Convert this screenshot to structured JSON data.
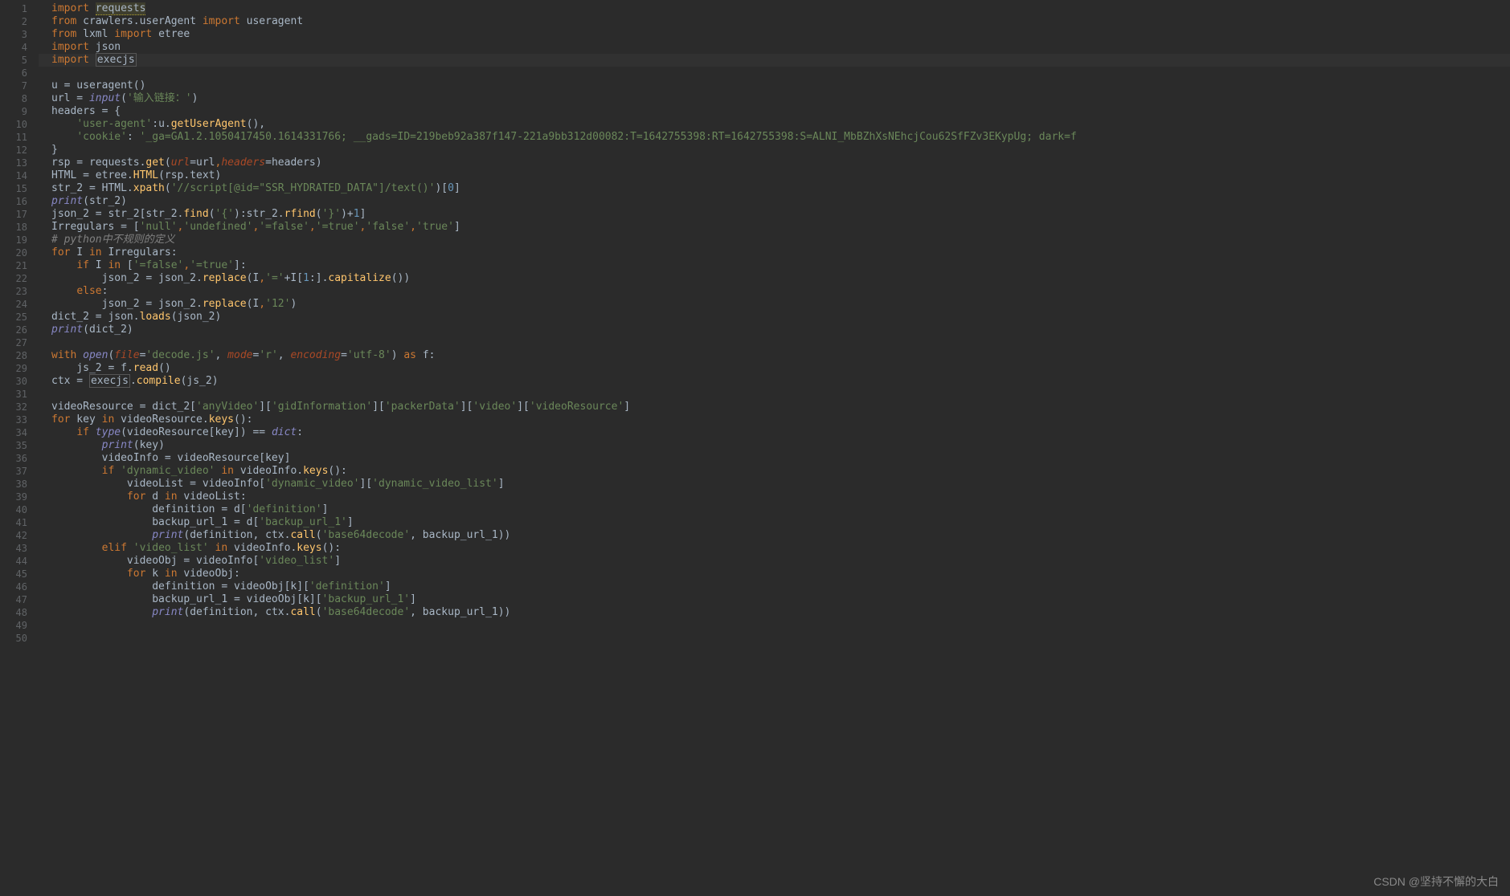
{
  "lineCount": 50,
  "caretLine": 5,
  "watermark": "CSDN @坚持不懈的大白",
  "code": {
    "lines": [
      {
        "n": 1,
        "tokens": [
          [
            "kw",
            "import"
          ],
          [
            "op",
            " "
          ],
          [
            "warn",
            "requests"
          ]
        ]
      },
      {
        "n": 2,
        "tokens": [
          [
            "kw",
            "from"
          ],
          [
            "op",
            " crawlers.userAgent "
          ],
          [
            "kw",
            "import"
          ],
          [
            "op",
            " useragent"
          ]
        ]
      },
      {
        "n": 3,
        "tokens": [
          [
            "kw",
            "from"
          ],
          [
            "op",
            " lxml "
          ],
          [
            "kw",
            "import"
          ],
          [
            "op",
            " etree"
          ]
        ]
      },
      {
        "n": 4,
        "tokens": [
          [
            "kw",
            "import"
          ],
          [
            "op",
            " json"
          ]
        ]
      },
      {
        "n": 5,
        "tokens": [
          [
            "kw",
            "import"
          ],
          [
            "op",
            " "
          ],
          [
            "boxed",
            "execjs"
          ]
        ]
      },
      {
        "n": 6,
        "tokens": []
      },
      {
        "n": 7,
        "tokens": [
          [
            "op",
            "u = useragent()"
          ]
        ]
      },
      {
        "n": 8,
        "tokens": [
          [
            "op",
            "url = "
          ],
          [
            "builtin",
            "input"
          ],
          [
            "op",
            "("
          ],
          [
            "str",
            "'输入链接：'"
          ],
          [
            "op",
            ")"
          ]
        ]
      },
      {
        "n": 9,
        "tokens": [
          [
            "op",
            "headers = {"
          ]
        ]
      },
      {
        "n": 10,
        "tokens": [
          [
            "op",
            "    "
          ],
          [
            "str",
            "'user-agent'"
          ],
          [
            "op",
            ":"
          ],
          [
            "op",
            "u."
          ],
          [
            "fn",
            "getUserAgent"
          ],
          [
            "op",
            "(),"
          ]
        ]
      },
      {
        "n": 11,
        "tokens": [
          [
            "op",
            "    "
          ],
          [
            "str",
            "'cookie'"
          ],
          [
            "op",
            ": "
          ],
          [
            "str",
            "'_ga=GA1.2.1050417450.1614331766; __gads=ID=219beb92a387f147-221a9bb312d00082:T=1642755398:RT=1642755398:S=ALNI_MbBZhXsNEhcjCou62SfFZv3EKypUg; dark=f"
          ]
        ]
      },
      {
        "n": 12,
        "tokens": [
          [
            "op",
            "}"
          ]
        ]
      },
      {
        "n": 13,
        "tokens": [
          [
            "op",
            "rsp = requests."
          ],
          [
            "fn",
            "get"
          ],
          [
            "op",
            "("
          ],
          [
            "param",
            "url"
          ],
          [
            "op",
            "=url"
          ],
          [
            "kw",
            ","
          ],
          [
            "param",
            "headers"
          ],
          [
            "op",
            "=headers)"
          ]
        ]
      },
      {
        "n": 14,
        "tokens": [
          [
            "op",
            "HTML = etree."
          ],
          [
            "fn",
            "HTML"
          ],
          [
            "op",
            "(rsp.text)"
          ]
        ]
      },
      {
        "n": 15,
        "tokens": [
          [
            "op",
            "str_2 = HTML."
          ],
          [
            "fn",
            "xpath"
          ],
          [
            "op",
            "("
          ],
          [
            "str",
            "'//script[@id=\"SSR_HYDRATED_DATA\"]/text()'"
          ],
          [
            "op",
            ")["
          ],
          [
            "num",
            "0"
          ],
          [
            "op",
            "]"
          ]
        ]
      },
      {
        "n": 16,
        "tokens": [
          [
            "builtin",
            "print"
          ],
          [
            "op",
            "(str_2)"
          ]
        ]
      },
      {
        "n": 17,
        "tokens": [
          [
            "op",
            "json_2 = str_2[str_2."
          ],
          [
            "fn",
            "find"
          ],
          [
            "op",
            "("
          ],
          [
            "str",
            "'{'"
          ],
          [
            "op",
            "):str_2."
          ],
          [
            "fn",
            "rfind"
          ],
          [
            "op",
            "("
          ],
          [
            "str",
            "'}'"
          ],
          [
            "op",
            ")+"
          ],
          [
            "num",
            "1"
          ],
          [
            "op",
            "]"
          ]
        ]
      },
      {
        "n": 18,
        "tokens": [
          [
            "op",
            "Irregulars = ["
          ],
          [
            "str",
            "'null'"
          ],
          [
            "kw",
            ","
          ],
          [
            "str",
            "'undefined'"
          ],
          [
            "kw",
            ","
          ],
          [
            "str",
            "'=false'"
          ],
          [
            "kw",
            ","
          ],
          [
            "str",
            "'=true'"
          ],
          [
            "kw",
            ","
          ],
          [
            "str",
            "'false'"
          ],
          [
            "kw",
            ","
          ],
          [
            "str",
            "'true'"
          ],
          [
            "op",
            "]"
          ]
        ]
      },
      {
        "n": 19,
        "tokens": [
          [
            "comment",
            "# python中不规则的定义"
          ]
        ]
      },
      {
        "n": 20,
        "tokens": [
          [
            "kw",
            "for"
          ],
          [
            "op",
            " I "
          ],
          [
            "kw",
            "in"
          ],
          [
            "op",
            " Irregulars:"
          ]
        ]
      },
      {
        "n": 21,
        "tokens": [
          [
            "op",
            "    "
          ],
          [
            "kw",
            "if"
          ],
          [
            "op",
            " I "
          ],
          [
            "kw",
            "in"
          ],
          [
            "op",
            " ["
          ],
          [
            "str",
            "'=false'"
          ],
          [
            "kw",
            ","
          ],
          [
            "str",
            "'=true'"
          ],
          [
            "op",
            "]:"
          ]
        ]
      },
      {
        "n": 22,
        "tokens": [
          [
            "op",
            "        json_2 = json_2."
          ],
          [
            "fn",
            "replace"
          ],
          [
            "op",
            "(I"
          ],
          [
            "kw",
            ","
          ],
          [
            "str",
            "'='"
          ],
          [
            "op",
            "+I["
          ],
          [
            "num",
            "1"
          ],
          [
            "op",
            ":]."
          ],
          [
            "fn",
            "capitalize"
          ],
          [
            "op",
            "())"
          ]
        ]
      },
      {
        "n": 23,
        "tokens": [
          [
            "op",
            "    "
          ],
          [
            "kw",
            "else"
          ],
          [
            "op",
            ":"
          ]
        ]
      },
      {
        "n": 24,
        "tokens": [
          [
            "op",
            "        json_2 = json_2."
          ],
          [
            "fn",
            "replace"
          ],
          [
            "op",
            "(I"
          ],
          [
            "kw",
            ","
          ],
          [
            "str",
            "'12'"
          ],
          [
            "op",
            ")"
          ]
        ]
      },
      {
        "n": 25,
        "tokens": [
          [
            "op",
            "dict_2 = json."
          ],
          [
            "fn",
            "loads"
          ],
          [
            "op",
            "(json_2)"
          ]
        ]
      },
      {
        "n": 26,
        "tokens": [
          [
            "builtin",
            "print"
          ],
          [
            "op",
            "(dict_2)"
          ]
        ]
      },
      {
        "n": 27,
        "tokens": []
      },
      {
        "n": 28,
        "tokens": [
          [
            "kw",
            "with"
          ],
          [
            "op",
            " "
          ],
          [
            "builtin",
            "open"
          ],
          [
            "op",
            "("
          ],
          [
            "param",
            "file"
          ],
          [
            "op",
            "="
          ],
          [
            "str",
            "'decode.js'"
          ],
          [
            "op",
            ", "
          ],
          [
            "param",
            "mode"
          ],
          [
            "op",
            "="
          ],
          [
            "str",
            "'r'"
          ],
          [
            "op",
            ", "
          ],
          [
            "param",
            "encoding"
          ],
          [
            "op",
            "="
          ],
          [
            "str",
            "'utf-8'"
          ],
          [
            "op",
            ") "
          ],
          [
            "kw",
            "as"
          ],
          [
            "op",
            " f:"
          ]
        ]
      },
      {
        "n": 29,
        "tokens": [
          [
            "op",
            "    js_2 = f."
          ],
          [
            "fn",
            "read"
          ],
          [
            "op",
            "()"
          ]
        ]
      },
      {
        "n": 30,
        "tokens": [
          [
            "op",
            "ctx = "
          ],
          [
            "boxed",
            "execjs"
          ],
          [
            "op",
            "."
          ],
          [
            "fn",
            "compile"
          ],
          [
            "op",
            "(js_2)"
          ]
        ]
      },
      {
        "n": 31,
        "tokens": []
      },
      {
        "n": 32,
        "tokens": [
          [
            "op",
            "videoResource = dict_2["
          ],
          [
            "str",
            "'anyVideo'"
          ],
          [
            "op",
            "]["
          ],
          [
            "str",
            "'gidInformation'"
          ],
          [
            "op",
            "]["
          ],
          [
            "str",
            "'packerData'"
          ],
          [
            "op",
            "]["
          ],
          [
            "str",
            "'video'"
          ],
          [
            "op",
            "]["
          ],
          [
            "str",
            "'videoResource'"
          ],
          [
            "op",
            "]"
          ]
        ]
      },
      {
        "n": 33,
        "tokens": [
          [
            "kw",
            "for"
          ],
          [
            "op",
            " key "
          ],
          [
            "kw",
            "in"
          ],
          [
            "op",
            " videoResource."
          ],
          [
            "fn",
            "keys"
          ],
          [
            "op",
            "():"
          ]
        ]
      },
      {
        "n": 34,
        "tokens": [
          [
            "op",
            "    "
          ],
          [
            "kw",
            "if"
          ],
          [
            "op",
            " "
          ],
          [
            "builtin",
            "type"
          ],
          [
            "op",
            "(videoResource[key]) == "
          ],
          [
            "builtin",
            "dict"
          ],
          [
            "op",
            ":"
          ]
        ]
      },
      {
        "n": 35,
        "tokens": [
          [
            "op",
            "        "
          ],
          [
            "builtin",
            "print"
          ],
          [
            "op",
            "(key)"
          ]
        ]
      },
      {
        "n": 36,
        "tokens": [
          [
            "op",
            "        videoInfo = videoResource[key]"
          ]
        ]
      },
      {
        "n": 37,
        "tokens": [
          [
            "op",
            "        "
          ],
          [
            "kw",
            "if"
          ],
          [
            "op",
            " "
          ],
          [
            "str",
            "'dynamic_video'"
          ],
          [
            "op",
            " "
          ],
          [
            "kw",
            "in"
          ],
          [
            "op",
            " videoInfo."
          ],
          [
            "fn",
            "keys"
          ],
          [
            "op",
            "():"
          ]
        ]
      },
      {
        "n": 38,
        "tokens": [
          [
            "op",
            "            videoList = videoInfo["
          ],
          [
            "str",
            "'dynamic_video'"
          ],
          [
            "op",
            "]["
          ],
          [
            "str",
            "'dynamic_video_list'"
          ],
          [
            "op",
            "]"
          ]
        ]
      },
      {
        "n": 39,
        "tokens": [
          [
            "op",
            "            "
          ],
          [
            "kw",
            "for"
          ],
          [
            "op",
            " d "
          ],
          [
            "kw",
            "in"
          ],
          [
            "op",
            " videoList:"
          ]
        ]
      },
      {
        "n": 40,
        "tokens": [
          [
            "op",
            "                definition = d["
          ],
          [
            "str",
            "'definition'"
          ],
          [
            "op",
            "]"
          ]
        ]
      },
      {
        "n": 41,
        "tokens": [
          [
            "op",
            "                backup_url_1 = d["
          ],
          [
            "str",
            "'backup_url_1'"
          ],
          [
            "op",
            "]"
          ]
        ]
      },
      {
        "n": 42,
        "tokens": [
          [
            "op",
            "                "
          ],
          [
            "builtin",
            "print"
          ],
          [
            "op",
            "(definition, ctx."
          ],
          [
            "fn",
            "call"
          ],
          [
            "op",
            "("
          ],
          [
            "str",
            "'base64decode'"
          ],
          [
            "op",
            ", backup_url_1))"
          ]
        ]
      },
      {
        "n": 43,
        "tokens": [
          [
            "op",
            "        "
          ],
          [
            "kw",
            "elif"
          ],
          [
            "op",
            " "
          ],
          [
            "str",
            "'video_list'"
          ],
          [
            "op",
            " "
          ],
          [
            "kw",
            "in"
          ],
          [
            "op",
            " videoInfo."
          ],
          [
            "fn",
            "keys"
          ],
          [
            "op",
            "():"
          ]
        ]
      },
      {
        "n": 44,
        "tokens": [
          [
            "op",
            "            videoObj = videoInfo["
          ],
          [
            "str",
            "'video_list'"
          ],
          [
            "op",
            "]"
          ]
        ]
      },
      {
        "n": 45,
        "tokens": [
          [
            "op",
            "            "
          ],
          [
            "kw",
            "for"
          ],
          [
            "op",
            " k "
          ],
          [
            "kw",
            "in"
          ],
          [
            "op",
            " videoObj:"
          ]
        ]
      },
      {
        "n": 46,
        "tokens": [
          [
            "op",
            "                definition = videoObj[k]["
          ],
          [
            "str",
            "'definition'"
          ],
          [
            "op",
            "]"
          ]
        ]
      },
      {
        "n": 47,
        "tokens": [
          [
            "op",
            "                backup_url_1 = videoObj[k]["
          ],
          [
            "str",
            "'backup_url_1'"
          ],
          [
            "op",
            "]"
          ]
        ]
      },
      {
        "n": 48,
        "tokens": [
          [
            "op",
            "                "
          ],
          [
            "builtin",
            "print"
          ],
          [
            "op",
            "(definition, ctx."
          ],
          [
            "fn",
            "call"
          ],
          [
            "op",
            "("
          ],
          [
            "str",
            "'base64decode'"
          ],
          [
            "op",
            ", backup_url_1))"
          ]
        ]
      },
      {
        "n": 49,
        "tokens": []
      },
      {
        "n": 50,
        "tokens": []
      }
    ]
  }
}
